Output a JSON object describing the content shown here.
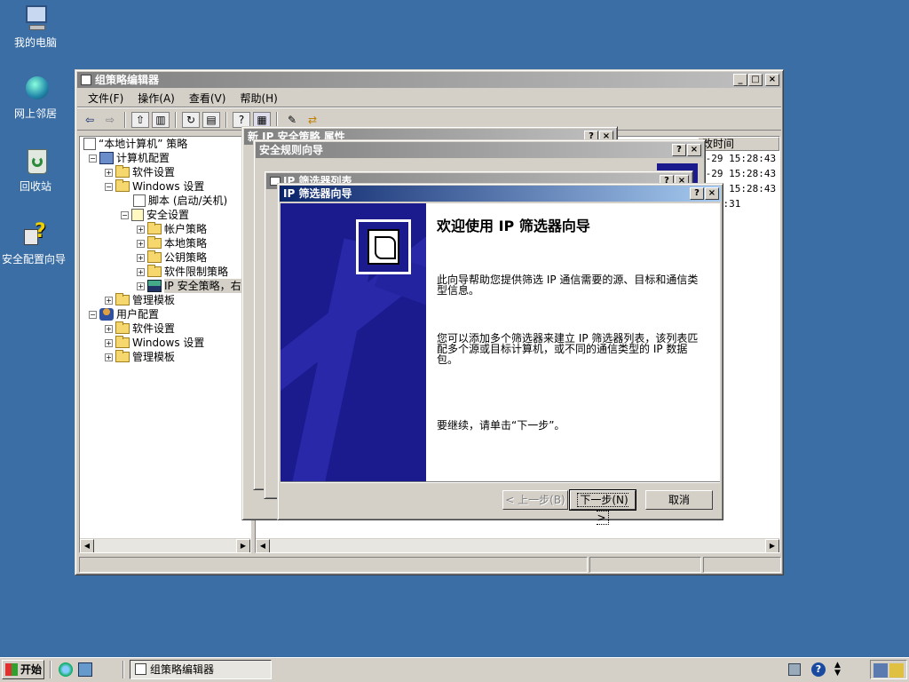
{
  "desktop": {
    "icons": [
      {
        "label": "我的电脑",
        "icon": "my-computer-icon"
      },
      {
        "label": "网上邻居",
        "icon": "network-places-icon"
      },
      {
        "label": "回收站",
        "icon": "recycle-bin-icon"
      },
      {
        "label": "安全配置向导",
        "icon": "security-wizard-icon"
      }
    ]
  },
  "gpo_window": {
    "title": "组策略编辑器",
    "menu": [
      "文件(F)",
      "操作(A)",
      "查看(V)",
      "帮助(H)"
    ],
    "tree": [
      {
        "label": "“本地计算机” 策略"
      },
      {
        "label": "计算机配置"
      },
      {
        "label": "软件设置"
      },
      {
        "label": "Windows 设置"
      },
      {
        "label": "脚本 (启动/关机)"
      },
      {
        "label": "安全设置"
      },
      {
        "label": "帐户策略"
      },
      {
        "label": "本地策略"
      },
      {
        "label": "公钥策略"
      },
      {
        "label": "软件限制策略"
      },
      {
        "label": "IP 安全策略，右"
      },
      {
        "label": "管理模板"
      },
      {
        "label": "用户配置"
      },
      {
        "label": "软件设置"
      },
      {
        "label": "Windows 设置"
      },
      {
        "label": "管理模板"
      }
    ],
    "right_pane": {
      "column_header": "改时间",
      "times": [
        "0-29 15:28:43",
        "0-29 15:28:43",
        "0-29 15:28:43",
        "3:24:31"
      ]
    }
  },
  "dialogs": {
    "props_title": "新 IP 安全策略 属性",
    "rule_wizard_title": "安全规则向导",
    "filter_list_title": "IP 筛选器列表"
  },
  "wizard": {
    "title": "IP 筛选器向导",
    "heading": "欢迎使用 IP 筛选器向导",
    "para1": "此向导帮助您提供筛选 IP 通信需要的源、目标和通信类型信息。",
    "para2": "您可以添加多个筛选器来建立 IP 筛选器列表，该列表匹配多个源或目标计算机，或不同的通信类型的 IP 数据包。",
    "para3": "要继续，请单击“下一步”。",
    "back_label": "< 上一步(B)",
    "next_label": "下一步(N) >",
    "cancel_label": "取消"
  },
  "taskbar": {
    "start_label": "开始",
    "task_label": "组策略编辑器"
  }
}
